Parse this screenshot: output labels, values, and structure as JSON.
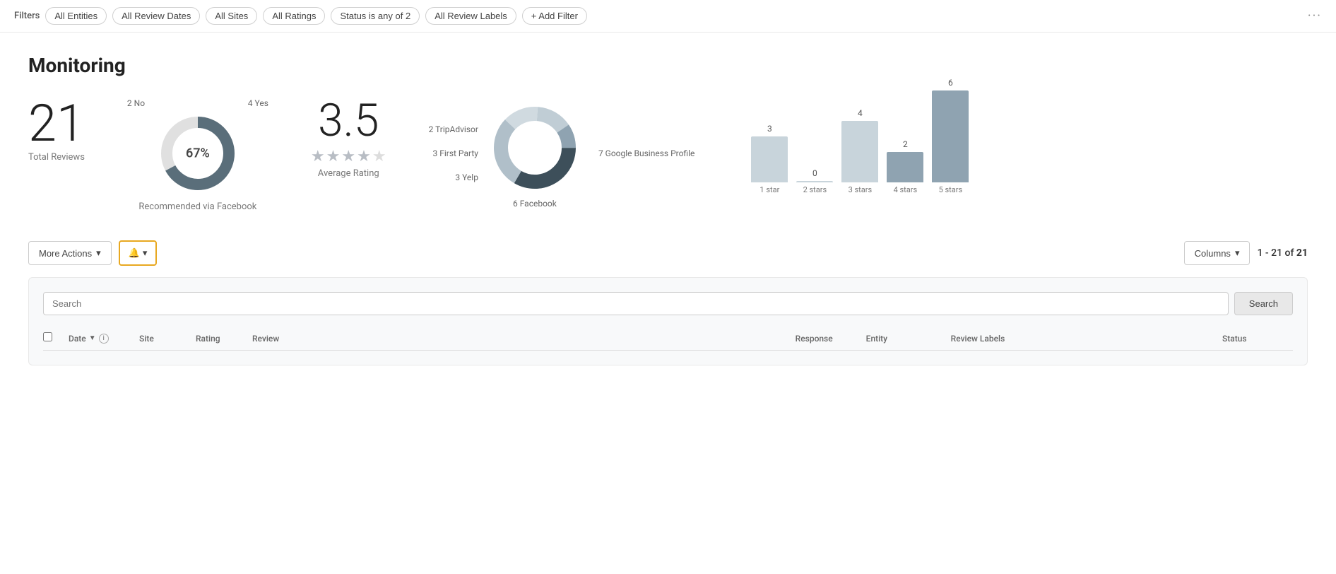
{
  "filterBar": {
    "label": "Filters",
    "chips": [
      {
        "id": "entities",
        "label": "All Entities"
      },
      {
        "id": "review-dates",
        "label": "All Review Dates"
      },
      {
        "id": "sites",
        "label": "All Sites"
      },
      {
        "id": "ratings",
        "label": "All Ratings"
      },
      {
        "id": "status",
        "label": "Status is any of 2"
      },
      {
        "id": "review-labels",
        "label": "All Review Labels"
      }
    ],
    "addFilter": "+ Add Filter",
    "more": "···"
  },
  "page": {
    "title": "Monitoring"
  },
  "stats": {
    "totalReviews": {
      "number": "21",
      "label": "Total Reviews"
    },
    "facebook": {
      "noLabel": "2 No",
      "yesLabel": "4 Yes",
      "percentage": "67%",
      "bottomLabel": "Recommended via Facebook"
    },
    "avgRating": {
      "number": "3.5",
      "label": "Average Rating",
      "starsDisplay": "★★★½☆"
    },
    "siteDonut": {
      "tripadvisor": "2 TripAdvisor",
      "firstParty": "3 First Party",
      "yelp": "3 Yelp",
      "facebook": "6 Facebook",
      "google": "7 Google Business Profile"
    },
    "barChart": {
      "bars": [
        {
          "label": "1 star",
          "value": 3,
          "light": true
        },
        {
          "label": "2 stars",
          "value": 0,
          "light": true
        },
        {
          "label": "3 stars",
          "value": 4,
          "light": true
        },
        {
          "label": "4 stars",
          "value": 2,
          "light": false
        },
        {
          "label": "5 stars",
          "value": 6,
          "light": false
        }
      ],
      "maxValue": 6
    }
  },
  "actions": {
    "moreActions": "More Actions",
    "columns": "Columns",
    "paginationStart": "1 - 21",
    "paginationOf": "of",
    "paginationTotal": "21"
  },
  "table": {
    "searchPlaceholder": "Search",
    "searchButton": "Search",
    "columns": [
      {
        "id": "date",
        "label": "Date",
        "sortable": true,
        "info": true
      },
      {
        "id": "site",
        "label": "Site"
      },
      {
        "id": "rating",
        "label": "Rating"
      },
      {
        "id": "review",
        "label": "Review"
      },
      {
        "id": "response",
        "label": "Response"
      },
      {
        "id": "entity",
        "label": "Entity"
      },
      {
        "id": "review-labels",
        "label": "Review Labels"
      },
      {
        "id": "status",
        "label": "Status"
      }
    ]
  }
}
